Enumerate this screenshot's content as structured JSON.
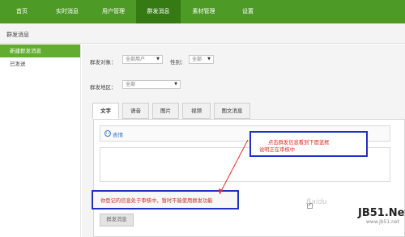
{
  "nav": {
    "tabs": [
      {
        "label": "首页"
      },
      {
        "label": "实时消息"
      },
      {
        "label": "用户管理"
      },
      {
        "label": "群发消息"
      },
      {
        "label": "素材管理"
      },
      {
        "label": "设置"
      }
    ],
    "active_index": 3
  },
  "page": {
    "title": "群发消息"
  },
  "sidebar": {
    "items": [
      {
        "label": "新建群发消息"
      },
      {
        "label": "已发送"
      }
    ],
    "active_index": 0
  },
  "filters": {
    "target_label": "群发对象：",
    "target_value": "全部用户",
    "gender_label": "性别：",
    "gender_value": "全部",
    "region_label": "群发地区：",
    "region_value": "全部"
  },
  "content_tabs": [
    {
      "label": "文字"
    },
    {
      "label": "语音"
    },
    {
      "label": "图片"
    },
    {
      "label": "视频"
    },
    {
      "label": "图文消息"
    }
  ],
  "editor": {
    "emoji_label": "表情"
  },
  "notice": {
    "text": "你登记的信息处于审核中，暂时不能使用群发功能"
  },
  "send_button": "群发消息",
  "annotation": {
    "line1": "点击群发信息看到下面蓝框",
    "line2": "说明正在审核中"
  },
  "watermark": {
    "baidu": "Baidu",
    "jb51": "JB51.Net",
    "jb51_sub": "www.jb51.net"
  },
  "colors": {
    "nav_bg": "#4e9a26",
    "nav_active": "#357a13",
    "sidebar_active": "#61ad32",
    "notice_border": "#2030c0",
    "notice_text": "#c0301e",
    "annotation_text": "#d62f1f"
  }
}
